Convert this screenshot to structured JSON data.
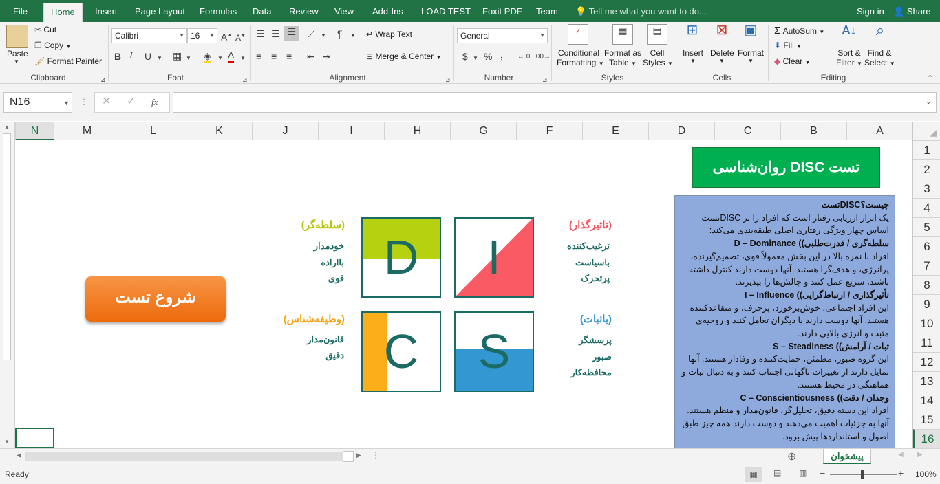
{
  "tabs": [
    "File",
    "Home",
    "Insert",
    "Page Layout",
    "Formulas",
    "Data",
    "Review",
    "View",
    "Add-Ins",
    "LOAD TEST",
    "Foxit PDF",
    "Team"
  ],
  "tell_me": "Tell me what you want to do...",
  "sign_in": "Sign in",
  "share": "Share",
  "clipboard": {
    "paste": "Paste",
    "cut": "Cut",
    "copy": "Copy",
    "format_painter": "Format Painter",
    "label": "Clipboard"
  },
  "font": {
    "name": "Calibri",
    "size": "16",
    "bold": "B",
    "italic": "I",
    "underline": "U",
    "label": "Font"
  },
  "alignment": {
    "wrap": "Wrap Text",
    "merge": "Merge & Center",
    "label": "Alignment"
  },
  "number": {
    "format": "General",
    "currency": "$",
    "percent": "%",
    "comma": ",",
    "label": "Number"
  },
  "styles": {
    "cond": "Conditional",
    "cond2": "Formatting",
    "fmt_table": "Format as",
    "fmt_table2": "Table",
    "cell_styles": "Cell",
    "cell_styles2": "Styles",
    "label": "Styles"
  },
  "cells": {
    "insert": "Insert",
    "delete": "Delete",
    "format": "Format",
    "label": "Cells"
  },
  "editing": {
    "autosum": "AutoSum",
    "fill": "Fill",
    "clear": "Clear",
    "sort": "Sort &",
    "sort2": "Filter",
    "find": "Find &",
    "find2": "Select",
    "label": "Editing"
  },
  "name_box": "N16",
  "fx": "fx",
  "columns": [
    "A",
    "B",
    "C",
    "D",
    "E",
    "F",
    "G",
    "H",
    "I",
    "J",
    "K",
    "L",
    "M",
    "N"
  ],
  "rows": [
    "1",
    "2",
    "3",
    "4",
    "5",
    "6",
    "7",
    "8",
    "9",
    "10",
    "11",
    "12",
    "13",
    "14",
    "15",
    "16"
  ],
  "title": "تست  DISC روان‌شناسی",
  "start_button": "شروع تست",
  "quad": {
    "D": {
      "letter": "D",
      "head": "(سلطه‌گر)",
      "traits": [
        "خودمدار",
        "بااراده",
        "قوی"
      ]
    },
    "I": {
      "letter": "I",
      "head": "(تاثیرگذار)",
      "traits": [
        "ترغیب‌کننده",
        "باسیاست",
        "پرتحرک"
      ]
    },
    "C": {
      "letter": "C",
      "head": "(وظیفه‌شناس)",
      "traits": [
        "قانون‌مدار",
        "دقیق"
      ]
    },
    "S": {
      "letter": "S",
      "head": "(باثبات)",
      "traits": [
        "پرسشگر",
        "صبور",
        "محافظه‌کار"
      ]
    }
  },
  "desc": {
    "q": "چیست؟DISCتست",
    "intro": "یک ابزار ارزیابی رفتار است که افراد را بر   DISCتست اساس چهار ویژگی رفتاری اصلی طبقه‌بندی می‌کند:",
    "d_head": "سلطه‌گری / قدرت‌طلبی)) D – Dominance",
    "d_text": "افراد با نمره بالا در این بخش معمولاً قوی، تصمیم‌گیرنده، پرانرژی، و هدف‌گرا هستند. آنها دوست دارند کنترل داشته باشند، سریع عمل کنند و چالش‌ها را بپذیرند.",
    "i_head": "تأثیرگذاری / ارتباط‌گرایی)) I – Influence",
    "i_text": "این افراد اجتماعی، خوش‌برخورد، پرحرف، و متقاعدکننده هستند. آنها دوست دارند با دیگران تعامل کنند و روحیه‌ی مثبت و انرژی بالایی دارند.",
    "s_head": "ثبات / آرامش)) S – Steadiness",
    "s_text": "این گروه صبور، مطمئن، حمایت‌کننده و وفادار هستند. آنها تمایل دارند از تغییرات ناگهانی اجتناب کنند و به دنبال ثبات و هماهنگی در محیط هستند.",
    "c_head": "وجدان / دقت)) C – Conscientiousness",
    "c_text": "افراد این دسته دقیق، تحلیل‌گر، قانون‌مدار و منظم هستند. آنها به جزئیات اهمیت می‌دهند و دوست دارند همه چیز طبق اصول و استانداردها پیش برود."
  },
  "sheet_tab": "پیشخوان",
  "status": "Ready",
  "zoom": "100%",
  "colors": {
    "excel_green": "#217346",
    "title_green": "#00b050",
    "orange": "#f07b1c",
    "teal": "#1b6b64",
    "lime": "#b5d10f",
    "red": "#fa5a64",
    "amber": "#fbae1a",
    "blue": "#3397d1",
    "desc_bg": "#8ea9db"
  }
}
